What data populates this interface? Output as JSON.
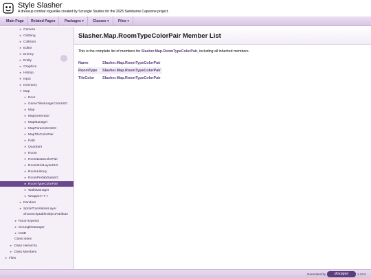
{
  "project": {
    "name": "Style Slasher",
    "brief": "A dreasup combat roguelike created by Scrungle Studios for the 2025 Swinburne Capstone project."
  },
  "nav": [
    {
      "label": "Main Page"
    },
    {
      "label": "Related Pages"
    },
    {
      "label": "Packages ▾"
    },
    {
      "label": "Classes ▾"
    },
    {
      "label": "Files ▾"
    }
  ],
  "sidebar": {
    "items": [
      {
        "label": "Camera",
        "arrow": "►"
      },
      {
        "label": "Clothing",
        "arrow": "►"
      },
      {
        "label": "Collision",
        "arrow": "►"
      },
      {
        "label": "Editor",
        "arrow": "►"
      },
      {
        "label": "Enemy",
        "arrow": "►"
      },
      {
        "label": "Entity",
        "arrow": "►"
      },
      {
        "label": "Graphics",
        "arrow": "►"
      },
      {
        "label": "Hitstop",
        "arrow": "►"
      },
      {
        "label": "Input",
        "arrow": "►"
      },
      {
        "label": "Inventory",
        "arrow": "►"
      },
      {
        "label": "Map",
        "arrow": "▼"
      },
      {
        "label": "Door",
        "arrow": "►"
      },
      {
        "label": "GameTilesImageColorsSO",
        "arrow": "►"
      },
      {
        "label": "Map",
        "arrow": "►"
      },
      {
        "label": "MapGenerator",
        "arrow": "►"
      },
      {
        "label": "MapManager",
        "arrow": "►"
      },
      {
        "label": "MapParametersSO",
        "arrow": "►"
      },
      {
        "label": "MapTileColorPair",
        "arrow": "►"
      },
      {
        "label": "Path",
        "arrow": "►"
      },
      {
        "label": "Quadrant",
        "arrow": "►"
      },
      {
        "label": "Room",
        "arrow": "►"
      },
      {
        "label": "RoomDataColorPair",
        "arrow": "►"
      },
      {
        "label": "RoomGridLayoutSO",
        "arrow": "►"
      },
      {
        "label": "RoomLibrary",
        "arrow": "►"
      },
      {
        "label": "RoomPrefabDataSO",
        "arrow": "►"
      },
      {
        "label": "RoomTypeColorPair",
        "arrow": "►"
      },
      {
        "label": "WallsManager",
        "arrow": "►"
      },
      {
        "label": "Wrapper< T >",
        "arrow": "►"
      },
      {
        "label": "Random",
        "arrow": "►"
      },
      {
        "label": "SpriteTranslationLayer",
        "arrow": "►"
      },
      {
        "label": "ShowScriptableObjectAttribute",
        "arrow": ""
      },
      {
        "label": "RoomTypeSO",
        "arrow": "►"
      },
      {
        "label": "ScrungleManager",
        "arrow": "►"
      },
      {
        "label": "testD",
        "arrow": "►"
      },
      {
        "label": "Class Index",
        "arrow": ""
      },
      {
        "label": "Class Hierarchy",
        "arrow": "►"
      },
      {
        "label": "Class Members",
        "arrow": "►"
      },
      {
        "label": "Files",
        "arrow": "►"
      }
    ],
    "sync_symbol": "⇔"
  },
  "content": {
    "title": "Slasher.Map.RoomTypeColorPair Member List",
    "intro_prefix": "This is the complete list of members for ",
    "intro_link": "Slasher.Map.RoomTypeColorPair",
    "intro_suffix": ", including all inherited members.",
    "members": [
      {
        "name": "Name",
        "cls": "Slasher.Map.RoomTypeColorPair"
      },
      {
        "name": "RoomType",
        "cls": "Slasher.Map.RoomTypeColorPair"
      },
      {
        "name": "TileColor",
        "cls": "Slasher.Map.RoomTypeColorPair"
      }
    ]
  },
  "footer": {
    "generated_by": "Generated by",
    "logo_text": "doxygen",
    "version": "1.13.2"
  },
  "colors": {
    "accent": "#69488b",
    "link": "#5b3e7c",
    "nav_bg": "#d8c6e3"
  }
}
